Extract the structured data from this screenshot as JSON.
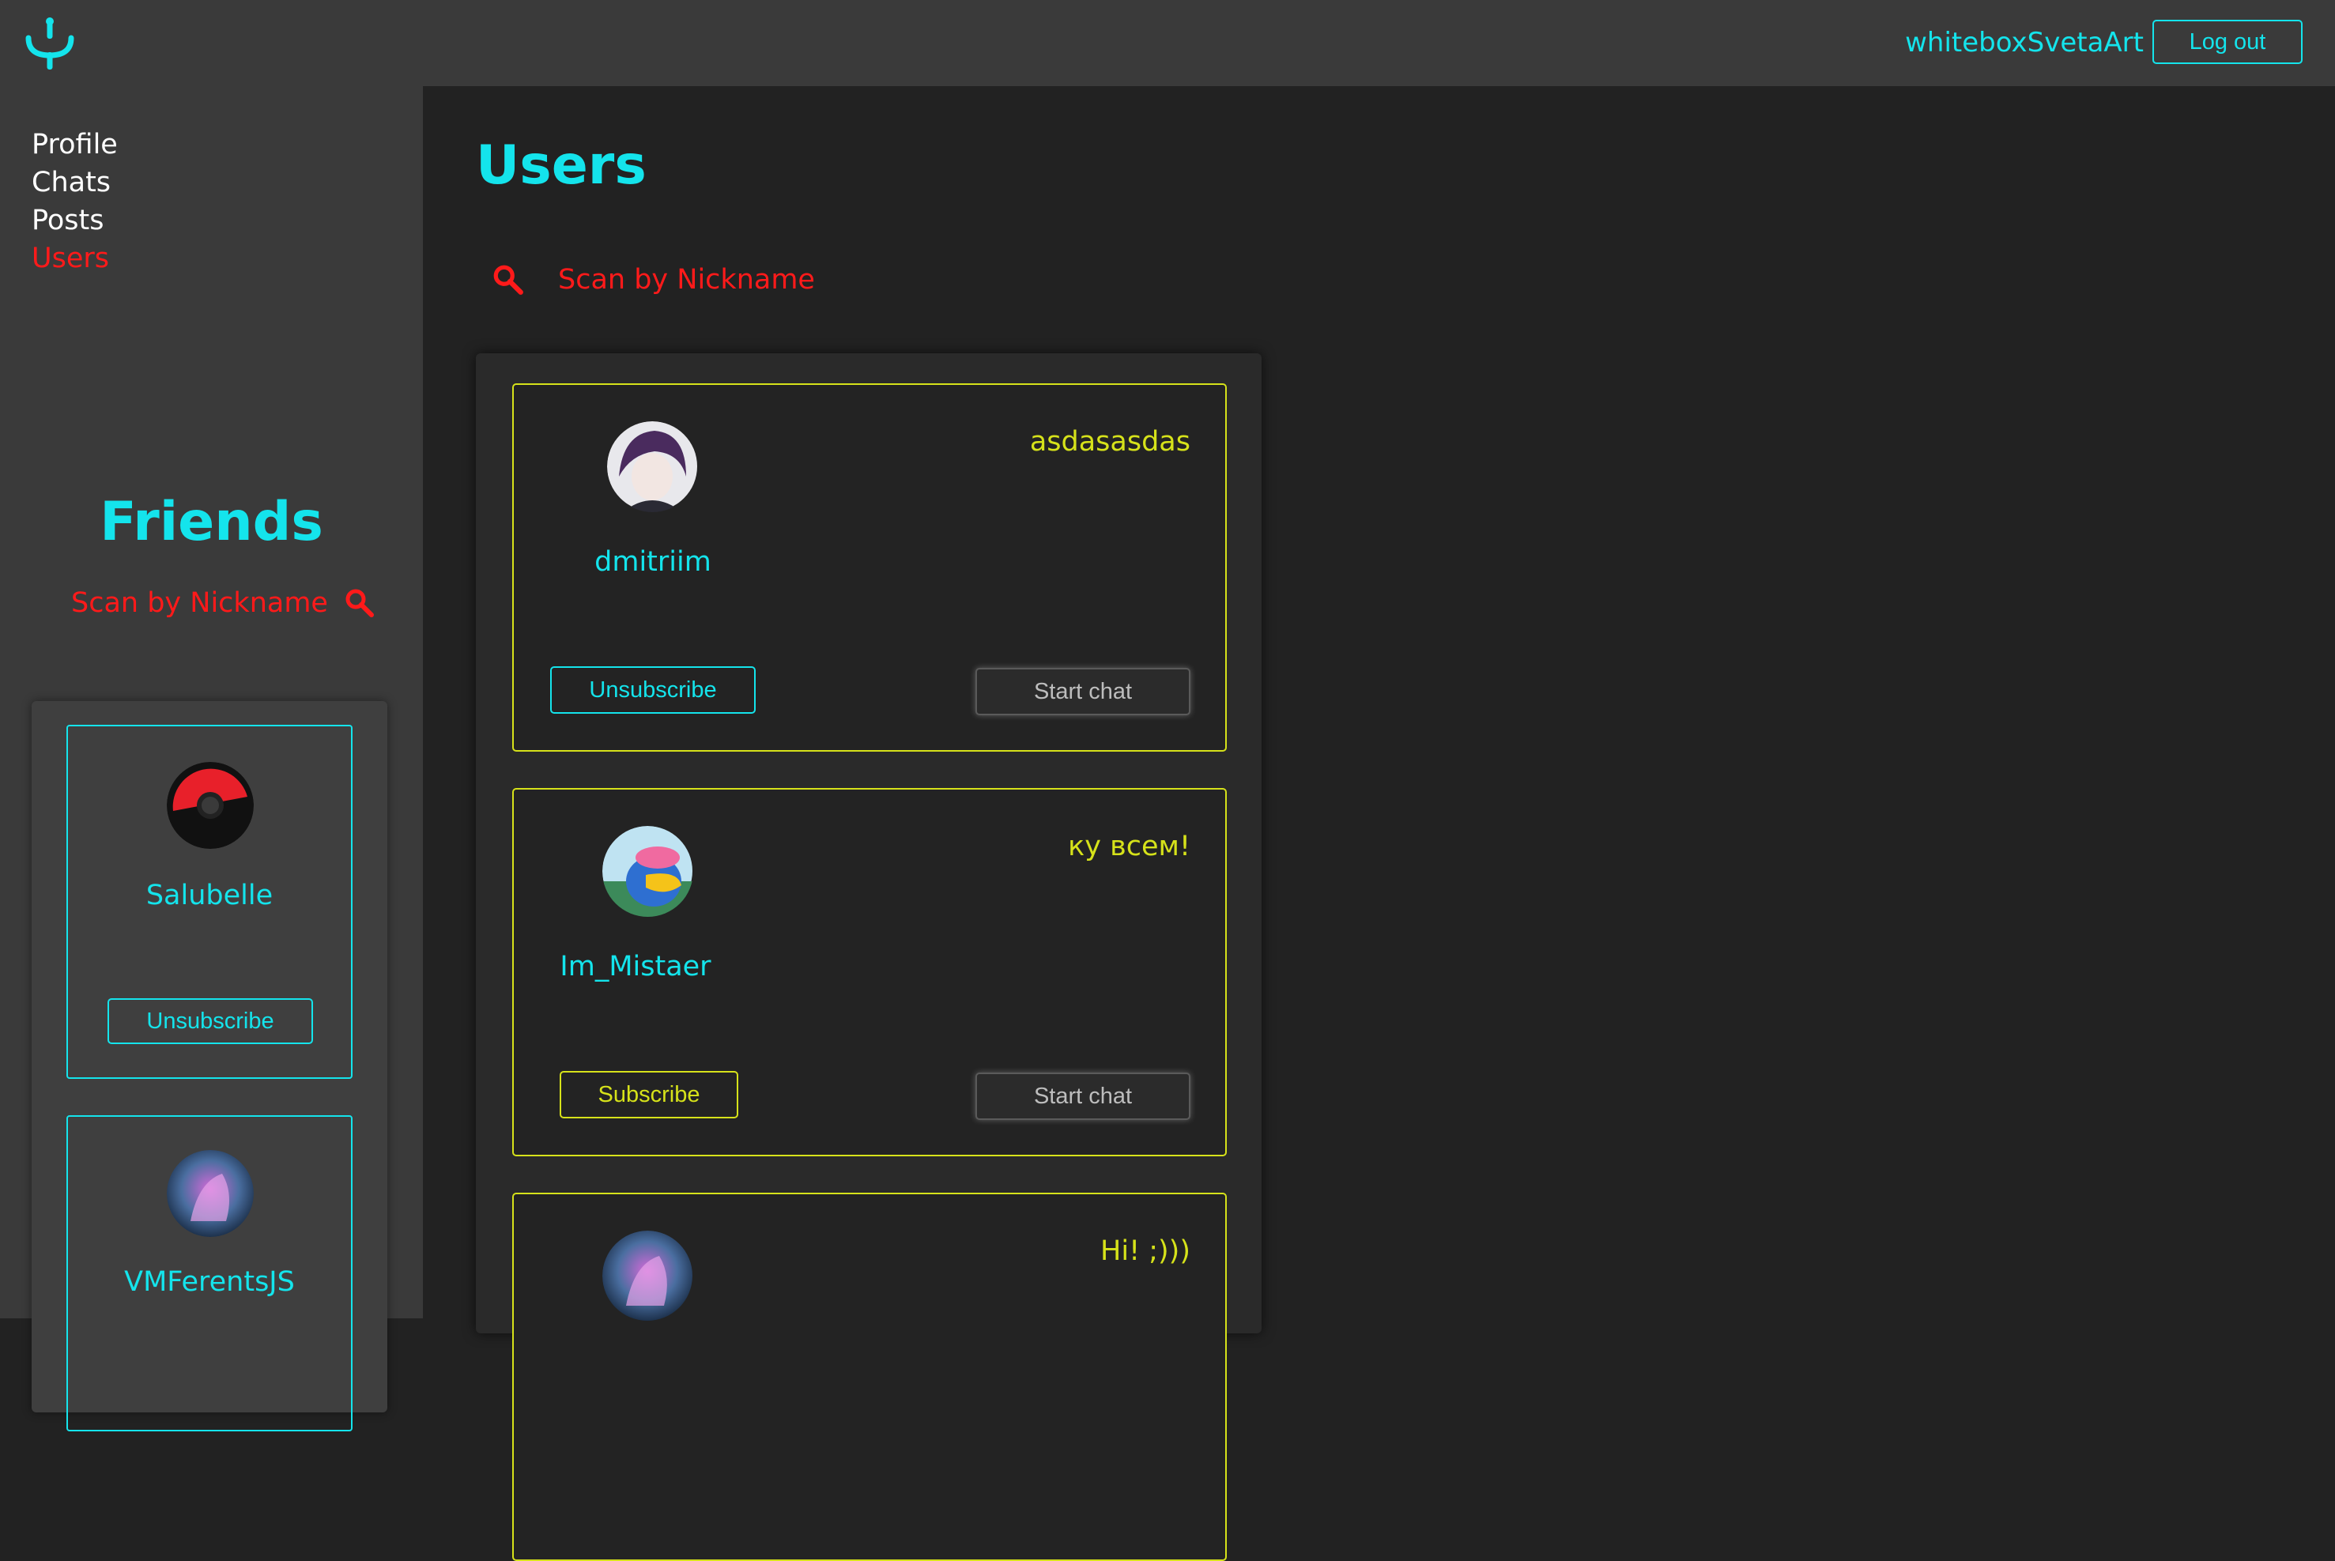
{
  "header": {
    "logo_icon": "fork-logo-icon",
    "username": "whiteboxSvetaArt",
    "logout_label": "Log out"
  },
  "sidebar": {
    "nav": [
      {
        "label": "Profile",
        "active": false
      },
      {
        "label": "Chats",
        "active": false
      },
      {
        "label": "Posts",
        "active": false
      },
      {
        "label": "Users",
        "active": true
      }
    ],
    "friends": {
      "title": "Friends",
      "search_placeholder": "Scan by Nickname",
      "search_icon": "search-icon",
      "items": [
        {
          "name": "Salubelle",
          "avatar": "pokeball-avatar",
          "button_label": "Unsubscribe"
        },
        {
          "name": "VMFerentsJS",
          "avatar": "space-unicorn-avatar"
        }
      ]
    }
  },
  "main": {
    "title": "Users",
    "search_placeholder": "Scan by Nickname",
    "search_icon": "search-icon",
    "users": [
      {
        "name": "dmitriim",
        "status": "asdasasdas",
        "avatar": "anime-girl-avatar",
        "subscribe_label": "Unsubscribe",
        "subscribed": true,
        "chat_label": "Start chat"
      },
      {
        "name": "Im_Mistaer",
        "status": "ку всем!",
        "avatar": "cartoon-bird-avatar",
        "subscribe_label": "Subscribe",
        "subscribed": false,
        "chat_label": "Start chat"
      },
      {
        "name": "",
        "status": "Hi! ;)))",
        "avatar": "space-unicorn-avatar"
      }
    ]
  },
  "colors": {
    "accent_cyan": "#14e4ec",
    "accent_red": "#ff1a1a",
    "accent_yellow": "#d6e21a",
    "header_bg": "#3a3a3a",
    "main_bg": "#222222"
  }
}
